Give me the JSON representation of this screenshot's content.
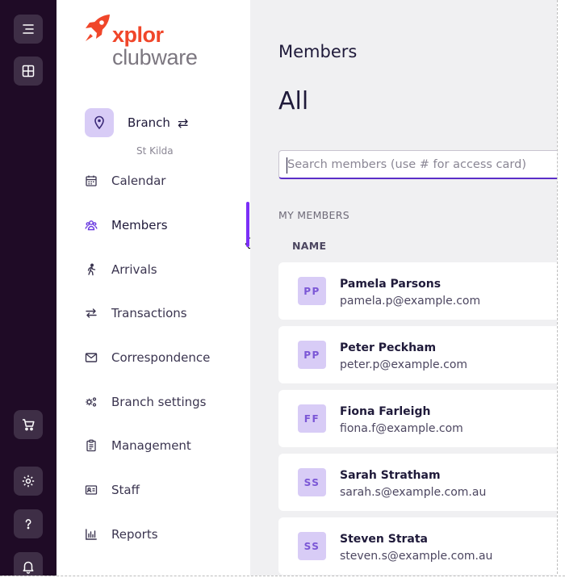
{
  "brand": {
    "line1": "xplor",
    "line2": "clubware",
    "accent": "#f0462a"
  },
  "rail": {
    "top_icons": [
      "menu-icon",
      "grid-icon"
    ],
    "bottom_icons": [
      "cart-icon",
      "settings-icon",
      "help-icon",
      "bell-icon"
    ]
  },
  "branch": {
    "label": "Branch",
    "swap_glyph": "⇄",
    "name": "St Kilda"
  },
  "nav": {
    "items": [
      {
        "label": "Calendar",
        "icon": "calendar-icon"
      },
      {
        "label": "Members",
        "icon": "members-icon",
        "active": true
      },
      {
        "label": "Arrivals",
        "icon": "walking-icon"
      },
      {
        "label": "Transactions",
        "icon": "transfer-icon"
      },
      {
        "label": "Correspondence",
        "icon": "envelope-icon"
      },
      {
        "label": "Branch settings",
        "icon": "cogs-icon"
      },
      {
        "label": "Management",
        "icon": "clipboard-icon"
      },
      {
        "label": "Staff",
        "icon": "id-card-icon"
      },
      {
        "label": "Reports",
        "icon": "bar-chart-icon"
      }
    ]
  },
  "main": {
    "breadcrumb": "Members",
    "title": "All",
    "search_placeholder": "Search members (use # for access card)",
    "section_label": "MY MEMBERS",
    "column_name": "NAME",
    "members": [
      {
        "initials": "PP",
        "name": "Pamela Parsons",
        "email": "pamela.p@example.com"
      },
      {
        "initials": "PP",
        "name": "Peter Peckham",
        "email": "peter.p@example.com"
      },
      {
        "initials": "FF",
        "name": "Fiona Farleigh",
        "email": "fiona.f@example.com"
      },
      {
        "initials": "SS",
        "name": "Sarah Stratham",
        "email": "sarah.s@example.com.au"
      },
      {
        "initials": "SS",
        "name": "Steven Strata",
        "email": "steven.s@example.com.au"
      }
    ]
  },
  "colors": {
    "primary": "#5b2ec8",
    "active_bar": "#7b2ff7",
    "rail_bg": "#1f0b26",
    "avatar_bg": "#d8ccf6"
  }
}
